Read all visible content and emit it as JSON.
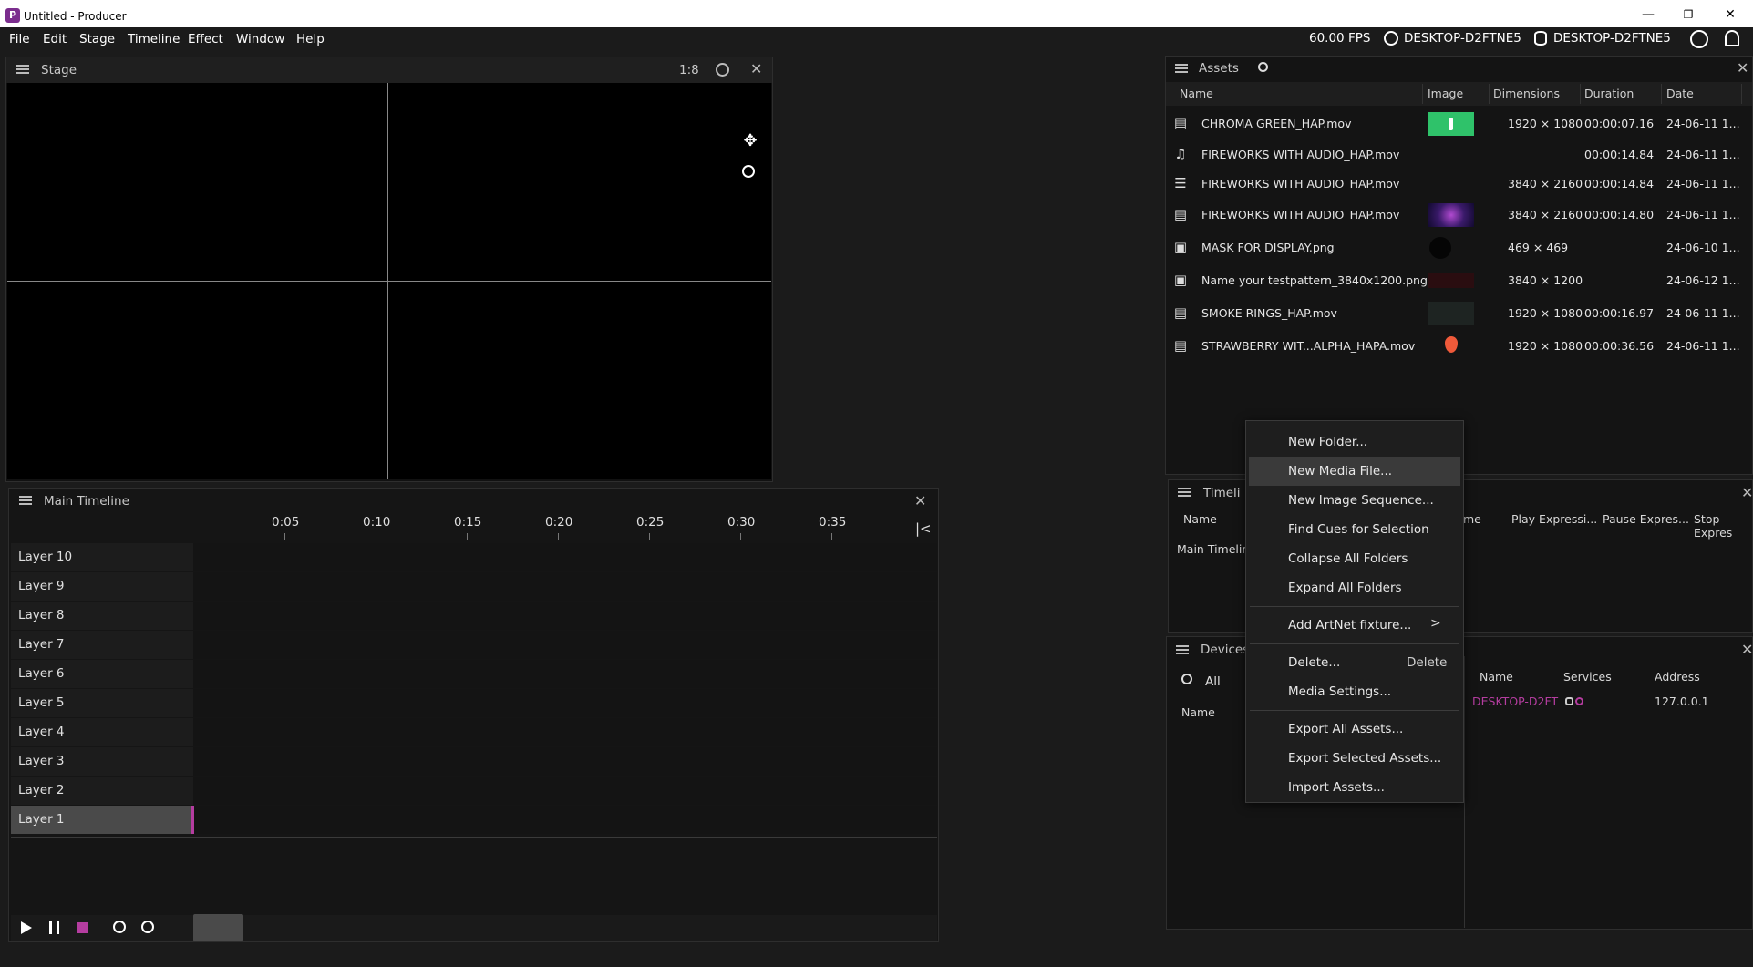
{
  "window": {
    "title": "Untitled - Producer",
    "app_icon": "P",
    "minimize": "—",
    "maximize": "❐",
    "close": "✕"
  },
  "menu": [
    "File",
    "Edit",
    "Stage",
    "Timeline",
    "Effect",
    "Window",
    "Help"
  ],
  "status": {
    "fps": "60.00 FPS",
    "network_host": "DESKTOP-D2FTNE5",
    "storage_host": "DESKTOP-D2FTNE5"
  },
  "stage": {
    "title": "Stage",
    "zoom": "1:8"
  },
  "timeline": {
    "title": "Main Timeline",
    "ticks": [
      "0:05",
      "0:10",
      "0:15",
      "0:20",
      "0:25",
      "0:30",
      "0:35"
    ],
    "layers": [
      "Layer 10",
      "Layer 9",
      "Layer 8",
      "Layer 7",
      "Layer 6",
      "Layer 5",
      "Layer 4",
      "Layer 3",
      "Layer 2",
      "Layer 1"
    ]
  },
  "assets": {
    "title": "Assets",
    "columns": [
      "Name",
      "Image",
      "Dimensions",
      "Duration",
      "Date"
    ],
    "rows": [
      {
        "icon": "video-icon",
        "name": "CHROMA GREEN_HAP.mov",
        "thumb": "green",
        "dims": "1920 × 1080",
        "duration": "00:00:07.16",
        "date": "24-06-11 1..."
      },
      {
        "icon": "audio-icon",
        "name": "FIREWORKS WITH AUDIO_HAP.mov",
        "thumb": "",
        "dims": "",
        "duration": "00:00:14.84",
        "date": "24-06-11 1..."
      },
      {
        "icon": "sequence-icon",
        "name": "FIREWORKS WITH AUDIO_HAP.mov",
        "thumb": "",
        "dims": "3840 × 2160",
        "duration": "00:00:14.84",
        "date": "24-06-11 1..."
      },
      {
        "icon": "video-icon",
        "name": "FIREWORKS WITH AUDIO_HAP.mov",
        "thumb": "fireworks",
        "dims": "3840 × 2160",
        "duration": "00:00:14.80",
        "date": "24-06-11 1..."
      },
      {
        "icon": "image-icon",
        "name": "MASK FOR DISPLAY.png",
        "thumb": "circle",
        "dims": "469 × 469",
        "duration": "",
        "date": "24-06-10 1..."
      },
      {
        "icon": "image-icon",
        "name": "Name your testpattern_3840x1200.png",
        "thumb": "pattern",
        "dims": "3840 × 1200",
        "duration": "",
        "date": "24-06-12 1..."
      },
      {
        "icon": "video-icon",
        "name": "SMOKE RINGS_HAP.mov",
        "thumb": "smoke",
        "dims": "1920 × 1080",
        "duration": "00:00:16.97",
        "date": "24-06-11 1..."
      },
      {
        "icon": "video-icon",
        "name": "STRAWBERRY WIT...ALPHA_HAPA.mov",
        "thumb": "strawberry",
        "dims": "1920 × 1080",
        "duration": "00:00:36.56",
        "date": "24-06-11 1..."
      }
    ]
  },
  "context_menu": {
    "groups": [
      [
        "New Folder...",
        "New Media File...",
        "New Image Sequence...",
        "Find Cues for Selection",
        "Collapse All Folders",
        "Expand All Folders"
      ],
      [
        "Add ArtNet fixture..."
      ],
      [
        "Delete...",
        "Media Settings..."
      ],
      [
        "Export All Assets...",
        "Export Selected Assets...",
        "Import Assets..."
      ]
    ],
    "delete_shortcut": "Delete",
    "submenu_arrow": ">"
  },
  "timelines_panel": {
    "title": "Timeli",
    "columns": [
      "Name",
      "me",
      "Play Expressi...",
      "Pause Expres...",
      "Stop Expres"
    ],
    "row": "Main Timelin"
  },
  "devices_panel": {
    "title": "Devices",
    "filter": "All",
    "left_column": "Name",
    "columns": [
      "Name",
      "Services",
      "Address"
    ],
    "device": {
      "name": "DESKTOP-D2FT",
      "address": "127.0.0.1"
    }
  },
  "colors": {
    "accent": "#b53da0",
    "playhead": "#b53da0"
  }
}
